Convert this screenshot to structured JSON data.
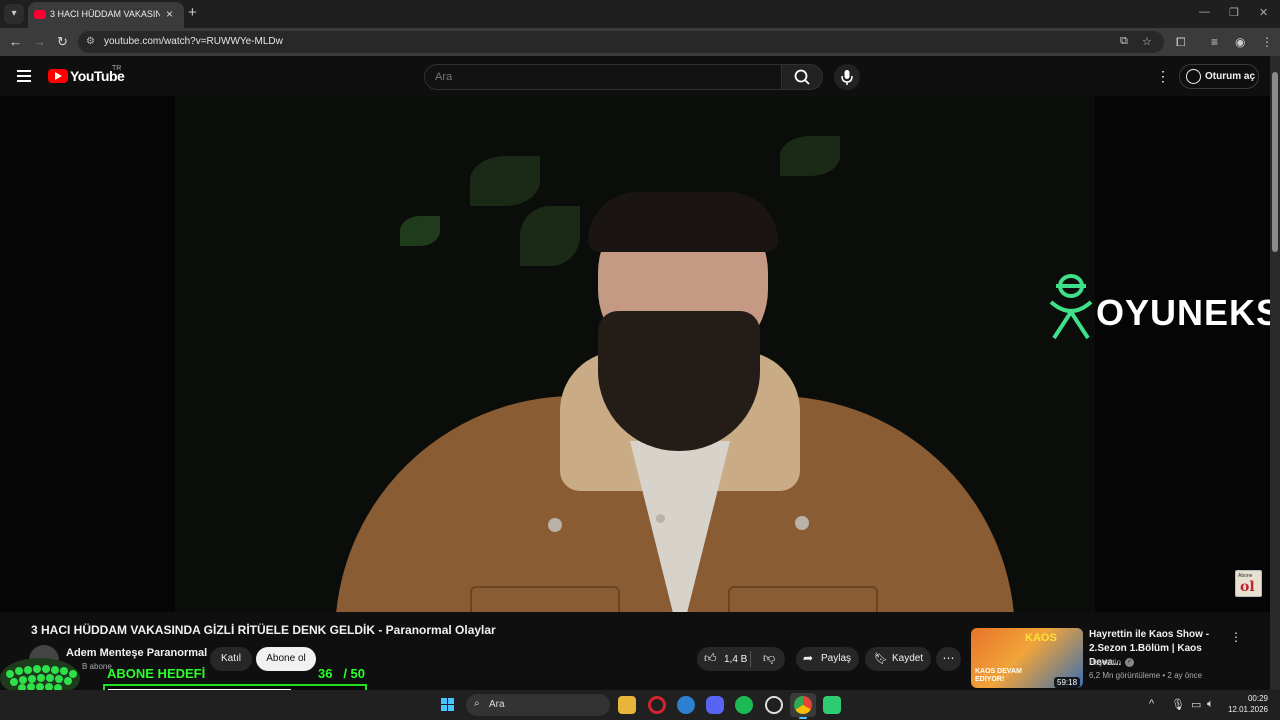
{
  "browser": {
    "tab_title": "3 HACI HÜDDAM VAKASINDA G",
    "url": "youtube.com/watch?v=RUWWYe-MLDw"
  },
  "youtube": {
    "logo_text": "YouTube",
    "country_code": "TR",
    "search_placeholder": "Ara",
    "signin_label": "Oturum aç"
  },
  "video": {
    "watermark_brand": "OYUNEKS",
    "corner_badge_top": "Abone",
    "corner_badge_main": "ol",
    "title": "3 HACI HÜDDAM VAKASINDA GİZLİ RİTÜELE DENK GELDİK - Paranormal Olaylar",
    "channel_name": "Adem Menteşe Paranormal",
    "channel_subs": "B abone",
    "join_label": "Katıl",
    "subscribe_label": "Abone ol",
    "likes": "1,4 B",
    "share_label": "Paylaş",
    "save_label": "Kaydet"
  },
  "related": {
    "title": "Hayrettin ile Kaos Show - 2.Sezon 1.Bölüm | Kaos Deva...",
    "thumb_text_top": "KAOS",
    "thumb_text_bottom": "KAOS DEVAM EDİYOR!",
    "duration": "59:18",
    "channel": "Hayrettin",
    "meta": "6,2 Mn görüntüleme • 2 ay önce"
  },
  "overlay": {
    "goal_label": "ABONE HEDEFİ",
    "goal_current": "36",
    "goal_target": "/ 50",
    "goal_progress": 0.72
  },
  "taskbar": {
    "search_label": "Ara",
    "time": "00:29",
    "date": "12.01.2026"
  },
  "colors": {
    "yt_red": "#ff0000",
    "goal_green": "#2bff2b",
    "watermark_green": "#3ee08a"
  }
}
